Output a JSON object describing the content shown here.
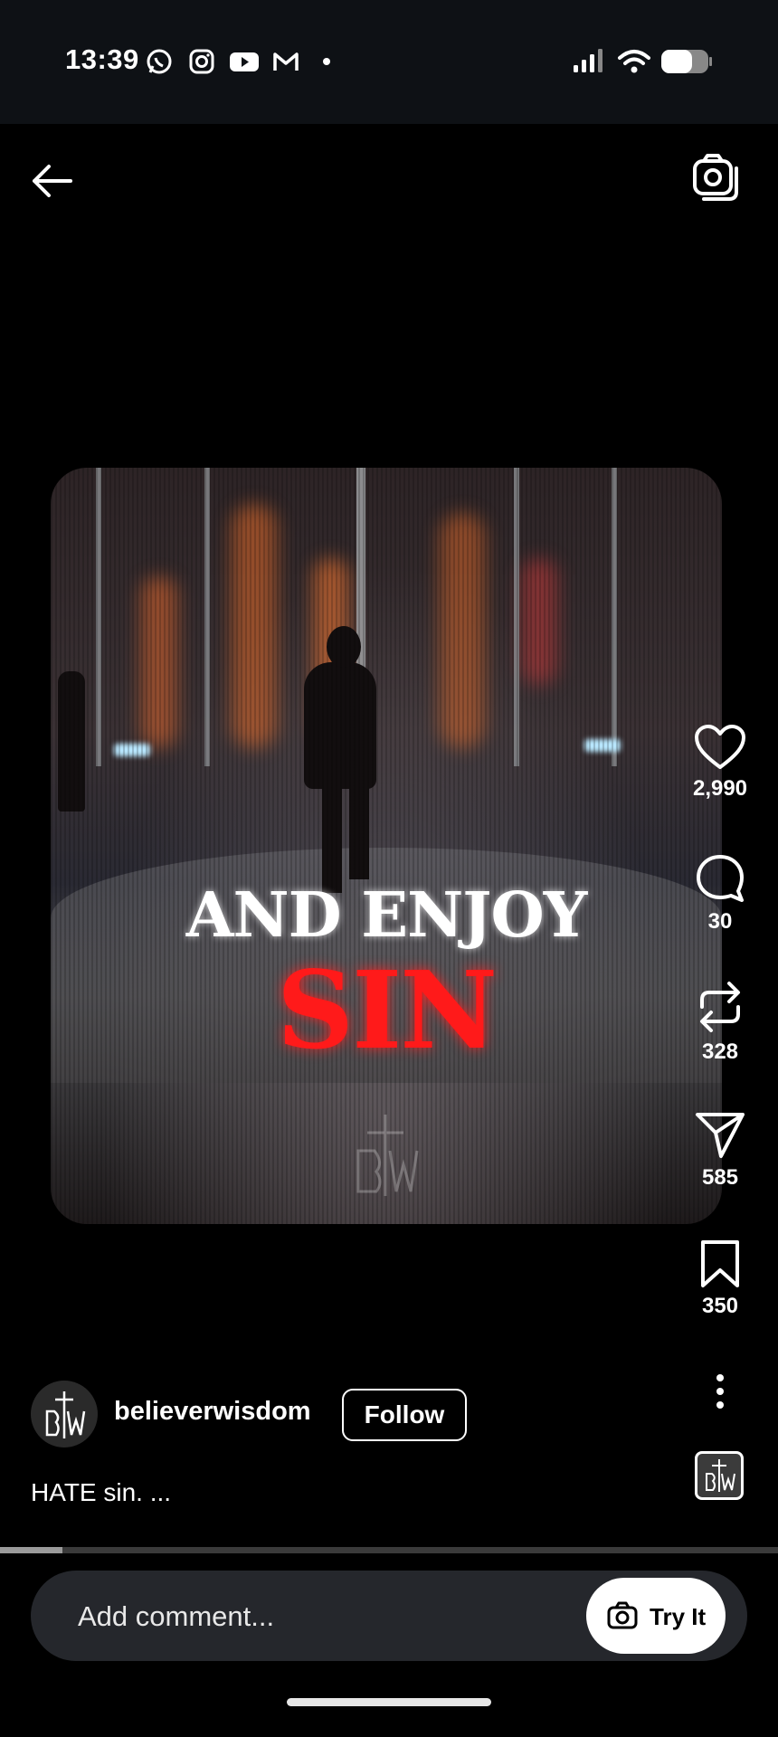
{
  "status_bar": {
    "time": "13:39",
    "notification_icons": [
      "whatsapp-icon",
      "instagram-icon",
      "youtube-icon",
      "gmail-icon"
    ],
    "system_icons": [
      "signal-icon",
      "wifi-icon",
      "battery-icon"
    ]
  },
  "top_bar": {
    "back_icon": "arrow-left-icon",
    "camera_icon": "camera-icon"
  },
  "video": {
    "overlay_line1": "AND ENJOY",
    "overlay_line2": "SIN",
    "overlay_line2_color": "#ff1a1a",
    "progress_fraction": 0.08
  },
  "actions": {
    "likes": "2,990",
    "comments": "30",
    "reposts": "328",
    "shares": "585",
    "saves": "350"
  },
  "author": {
    "username": "believerwisdom",
    "follow_label": "Follow"
  },
  "caption": "HATE sin. ...",
  "comment_bar": {
    "placeholder": "Add comment...",
    "try_it_label": "Try It"
  },
  "colors": {
    "status_bar_bg": "#0e1115",
    "comment_bar_bg": "#25272c"
  }
}
